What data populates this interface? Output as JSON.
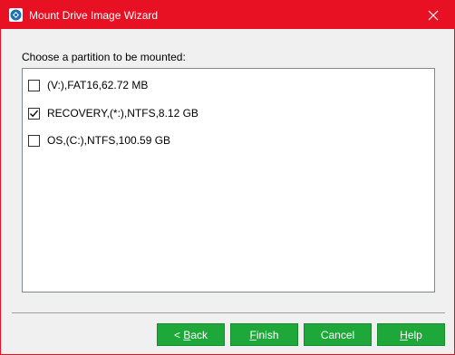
{
  "window": {
    "title": "Mount Drive Image Wizard",
    "accent_color": "#e81123",
    "app_icon": "mount-wizard-icon",
    "close_icon": "close-icon"
  },
  "prompt": "Choose a partition to be mounted:",
  "partitions": [
    {
      "label": "(V:),FAT16,62.72 MB",
      "checked": false
    },
    {
      "label": "RECOVERY,(*:),NTFS,8.12 GB",
      "checked": true
    },
    {
      "label": "OS,(C:),NTFS,100.59 GB",
      "checked": false
    }
  ],
  "buttons": {
    "back": {
      "arrow": "<",
      "key": "B",
      "rest": "ack"
    },
    "finish": {
      "key": "F",
      "rest": "inish"
    },
    "cancel": {
      "label": "Cancel"
    },
    "help": {
      "key": "H",
      "rest": "elp"
    },
    "color": "#1ea83a"
  }
}
